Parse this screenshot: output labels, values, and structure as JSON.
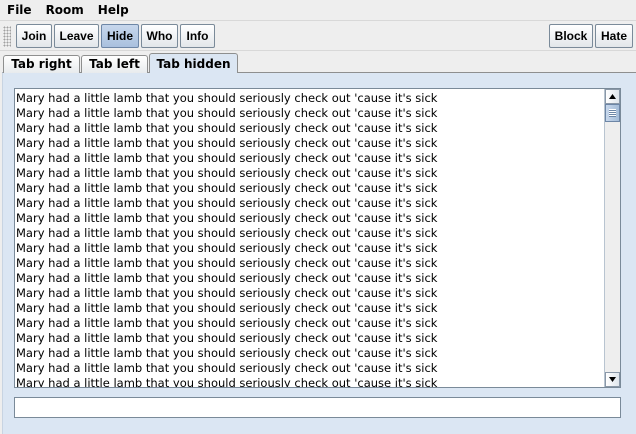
{
  "menu": {
    "file": "File",
    "room": "Room",
    "help": "Help"
  },
  "toolbar": {
    "join": "Join",
    "leave": "Leave",
    "hide": "Hide",
    "who": "Who",
    "info": "Info",
    "block": "Block",
    "hate": "Hate"
  },
  "tabs": [
    "Tab right",
    "Tab left",
    "Tab hidden"
  ],
  "chat": {
    "lines": [
      "Mary had a little lamb that you should seriously check out 'cause it's sick",
      "Mary had a little lamb that you should seriously check out 'cause it's sick",
      "Mary had a little lamb that you should seriously check out 'cause it's sick",
      "Mary had a little lamb that you should seriously check out 'cause it's sick",
      "Mary had a little lamb that you should seriously check out 'cause it's sick",
      "Mary had a little lamb that you should seriously check out 'cause it's sick",
      "Mary had a little lamb that you should seriously check out 'cause it's sick",
      "Mary had a little lamb that you should seriously check out 'cause it's sick",
      "Mary had a little lamb that you should seriously check out 'cause it's sick",
      "Mary had a little lamb that you should seriously check out 'cause it's sick",
      "Mary had a little lamb that you should seriously check out 'cause it's sick",
      "Mary had a little lamb that you should seriously check out 'cause it's sick",
      "Mary had a little lamb that you should seriously check out 'cause it's sick",
      "Mary had a little lamb that you should seriously check out 'cause it's sick",
      "Mary had a little lamb that you should seriously check out 'cause it's sick",
      "Mary had a little lamb that you should seriously check out 'cause it's sick",
      "Mary had a little lamb that you should seriously check out 'cause it's sick",
      "Mary had a little lamb that you should seriously check out 'cause it's sick",
      "Mary had a little lamb that you should seriously check out 'cause it's sick",
      "Mary had a little lamb that you should seriously check out 'cause it's sick"
    ]
  },
  "input": {
    "value": ""
  }
}
